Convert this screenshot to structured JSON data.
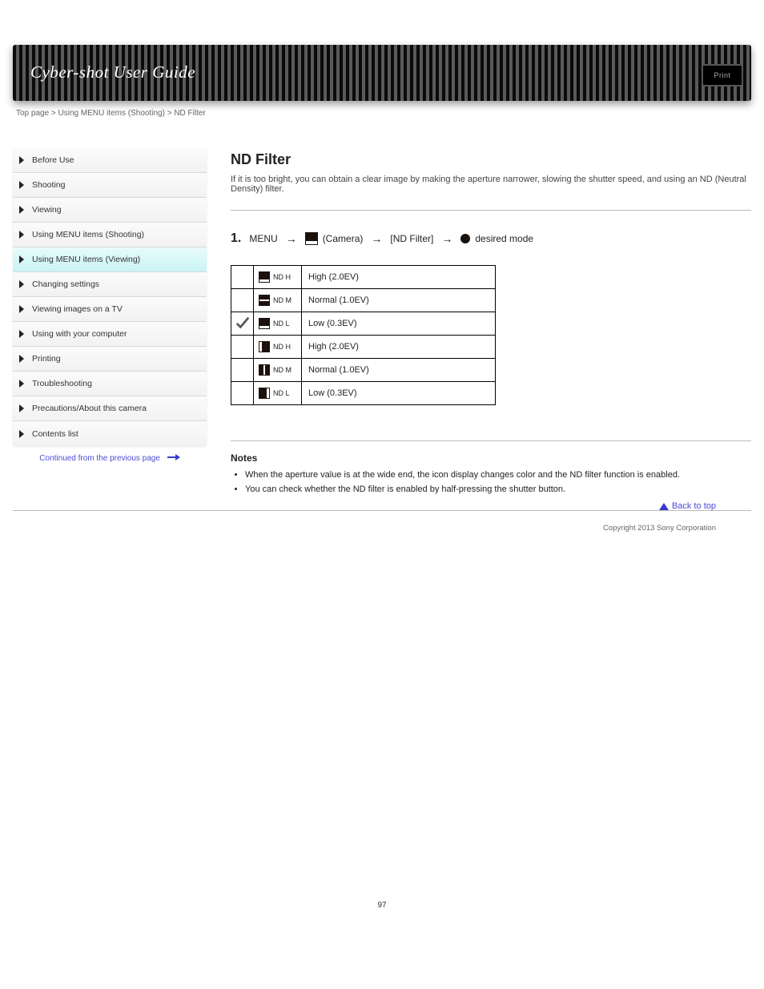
{
  "topbar": {
    "title": "Cyber-shot User Guide",
    "snap": "Print"
  },
  "breadcrumb": "Top page > Using MENU items (Shooting) > ND Filter",
  "sidebar": {
    "items": [
      {
        "label": "Before Use",
        "active": false
      },
      {
        "label": "Shooting",
        "active": false
      },
      {
        "label": "Viewing",
        "active": false
      },
      {
        "label": "Using MENU items (Shooting)",
        "active": false
      },
      {
        "label": "Using MENU items (Viewing)",
        "active": true
      },
      {
        "label": "Changing settings",
        "active": false
      },
      {
        "label": "Viewing images on a TV",
        "active": false
      },
      {
        "label": "Using with your computer",
        "active": false
      },
      {
        "label": "Printing",
        "active": false
      },
      {
        "label": "Troubleshooting",
        "active": false
      },
      {
        "label": "Precautions/About this camera",
        "active": false
      },
      {
        "label": "Contents list",
        "active": false
      }
    ],
    "continued": "Continued from the previous page"
  },
  "section": {
    "title": "ND Filter",
    "sub": "If it is too bright, you can obtain a clear image by making the aperture narrower, slowing the shutter speed, and using an ND (Neutral Density) filter.",
    "step": {
      "num": "1.",
      "part1": "MENU",
      "camera": "(Camera)",
      "nd": "[ND Filter]",
      "mode": "desired mode"
    },
    "table": [
      {
        "chk": false,
        "code": "ND H",
        "ico": "ihi",
        "label": "High (2.0EV)"
      },
      {
        "chk": false,
        "code": "ND M",
        "ico": "imid",
        "label": "Normal (1.0EV)"
      },
      {
        "chk": true,
        "code": "ND L",
        "ico": "ilow",
        "label": "Low (0.3EV)"
      },
      {
        "chk": false,
        "code": "ND H",
        "ico": "vihi",
        "label": "High (2.0EV)"
      },
      {
        "chk": false,
        "code": "ND M",
        "ico": "vimid",
        "label": "Normal (1.0EV)"
      },
      {
        "chk": false,
        "code": "ND L",
        "ico": "vilow",
        "label": "Low (0.3EV)"
      }
    ],
    "notes_h": "Notes",
    "notes": [
      "When the aperture value is at the wide end, the icon display changes color and the ND filter function is enabled.",
      "You can check whether the ND filter is enabled by half-pressing the shutter button."
    ]
  },
  "footer": {
    "backtop": "Back to top",
    "copy": "Copyright 2013 Sony Corporation"
  },
  "pagenum": "97"
}
